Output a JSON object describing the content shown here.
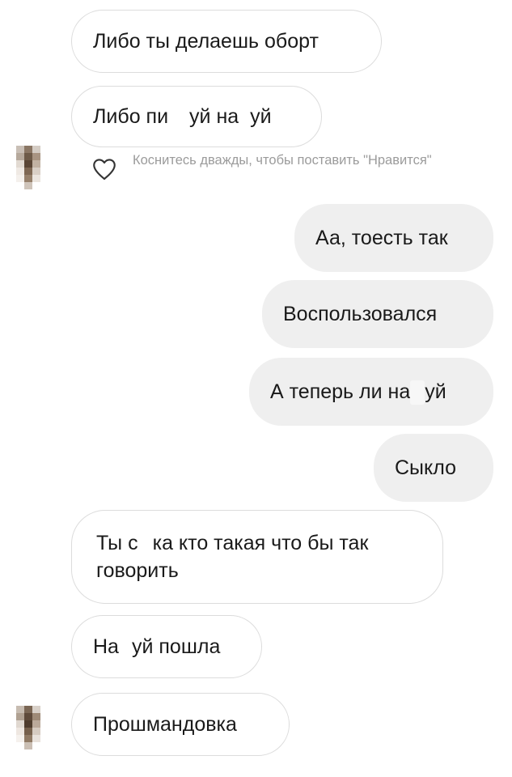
{
  "incoming_1": "Либо ты делаешь оборт",
  "incoming_2": {
    "a": "Либо пи",
    "b": "уй на",
    "c": "уй"
  },
  "like_hint": "Коснитесь дважды, чтобы поставить \"Нравится\"",
  "outgoing": {
    "m1": "Аа, тоесть так",
    "m2": "Воспользовался",
    "m3": {
      "a": "А теперь ли на",
      "b": "уй"
    },
    "m4": "Сыкло"
  },
  "incoming_3": {
    "a": "Ты с",
    "b": "ка кто такая что бы так говорить"
  },
  "incoming_4": {
    "a": "На",
    "b": "уй пошла"
  },
  "incoming_5": "Прошмандовка",
  "icons": {
    "like": "heart-outline-icon",
    "avatar": "pixelated-avatar"
  },
  "colors": {
    "outgoing_bubble": "#efefef",
    "incoming_border": "#dcdcdc",
    "hint_text": "#9b9b9b"
  }
}
